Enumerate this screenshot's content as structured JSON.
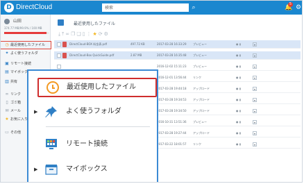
{
  "app": {
    "logo_letter": "D",
    "name": "DirectCloud"
  },
  "search": {
    "placeholder": "検索"
  },
  "header": {
    "notification_count": "5"
  },
  "sidebar": {
    "user_name": "山田",
    "storage_text": "374.77 MB/99.9% / 100 MB",
    "storage_fill_fraction": 0.95,
    "items": [
      {
        "label": "最近使用したファイル",
        "icon": "clock-icon"
      },
      {
        "label": "よく使うフォルダ",
        "icon": "pin-icon"
      },
      {
        "label": "リモート接続",
        "icon": "monitor-icon"
      },
      {
        "label": "マイボックス",
        "icon": "box-icon"
      },
      {
        "label": "共有",
        "icon": "share-icon"
      },
      {
        "label": "リンク",
        "icon": "link-icon"
      },
      {
        "label": "ゴミ箱",
        "icon": "trash-icon"
      },
      {
        "label": "メール",
        "icon": "mail-icon"
      },
      {
        "label": "お気に入り",
        "icon": "star-icon"
      },
      {
        "label": "その他",
        "icon": "folder-icon"
      }
    ]
  },
  "main": {
    "title": "最近使用したファイル",
    "rows": [
      {
        "name": "DirectCloud-BOX 料金表.pdf",
        "size": "497.72 KB",
        "date": "2017-03-28 16:33:29",
        "owner": "プレビュー",
        "selected": true
      },
      {
        "name": "DirectCloud-Box QuickGuide.pdf",
        "size": "2.87 MB",
        "date": "2017-03-28 16:35:48",
        "owner": "プレビュー",
        "selected": true
      },
      {
        "name": "",
        "size": "",
        "date": "2016-12-02 15:11:23",
        "owner": "プレビュー",
        "selected": false
      },
      {
        "name": "",
        "size": "",
        "date": "2016-12-01 13:56:44",
        "owner": "リンク",
        "selected": false
      },
      {
        "name": "",
        "size": "",
        "date": "2017-03-28 19:44:18",
        "owner": "アップロード",
        "selected": false
      },
      {
        "name": "",
        "size": "",
        "date": "2017-03-28 19:34:53",
        "owner": "アップロード",
        "selected": false
      },
      {
        "name": "",
        "size": "",
        "date": "2017-03-28 19:34:50",
        "owner": "アップロード",
        "selected": false
      },
      {
        "name": "",
        "size": "",
        "date": "2016-10-31 13:51:36",
        "owner": "プレビュー",
        "selected": false
      },
      {
        "name": "",
        "size": "",
        "date": "2017-03-28 19:27:44",
        "owner": "アップロード",
        "selected": false
      },
      {
        "name": "",
        "size": "",
        "date": "2017-03-22 18:01:57",
        "owner": "リンク",
        "selected": false
      }
    ]
  },
  "popover": {
    "items": [
      {
        "label": "最近使用したファイル",
        "icon": "clock-icon",
        "active": true
      },
      {
        "label": "よく使うフォルダ",
        "icon": "pin-icon",
        "expandable": true
      },
      {
        "label": "リモート接続",
        "icon": "monitor-icon"
      },
      {
        "label": "マイボックス",
        "icon": "box-icon",
        "expandable": true
      }
    ]
  },
  "colors": {
    "brand": "#1a87cf",
    "highlight": "#cf2d2d",
    "accent": "#f39a23"
  }
}
